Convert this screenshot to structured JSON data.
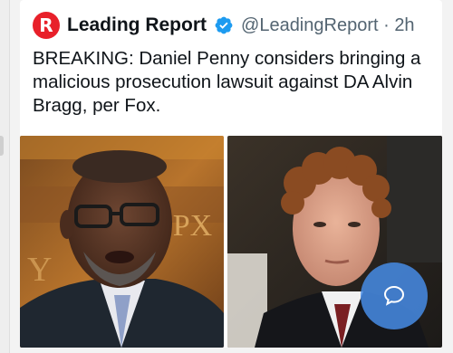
{
  "tweet": {
    "author_name": "Leading Report",
    "logo_letter": "R",
    "handle": "@LeadingReport",
    "separator": " · ",
    "time": "2h",
    "text": "BREAKING: Daniel Penny considers bringing a malicious prosecution lawsuit against DA Alvin Bragg, per Fox."
  },
  "media": {
    "left_photo_background_text": "EPX",
    "left_photo_background_text_2": "Y"
  },
  "colors": {
    "brand_red": "#e8202a",
    "verified_blue": "#1d9bf0",
    "text_primary": "#0f1419",
    "text_secondary": "#536471",
    "floating_button": "#468ce6"
  },
  "icons": {
    "verified": "verified-badge-icon",
    "chat": "chat-bubble-icon",
    "logo": "leading-report-logo"
  }
}
